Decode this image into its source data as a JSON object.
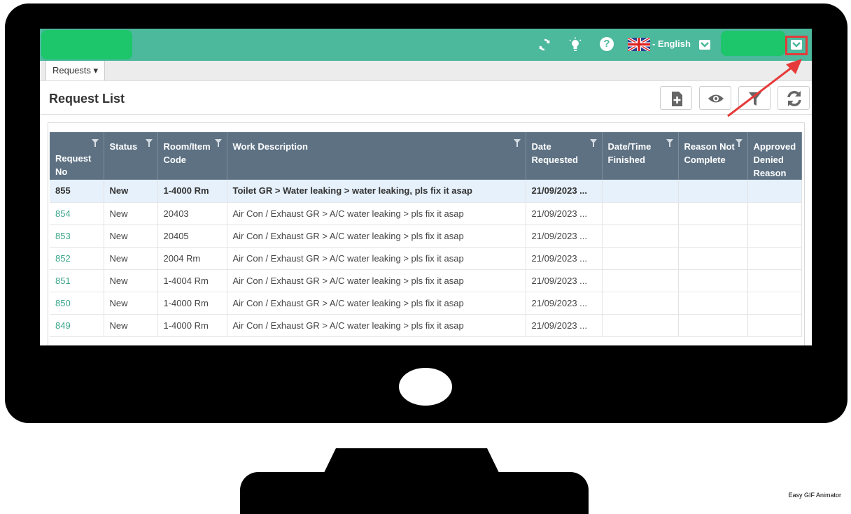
{
  "header": {
    "language": "- English"
  },
  "nav": {
    "requests_menu": "Requests ▾"
  },
  "page": {
    "title": "Request List"
  },
  "table": {
    "headers": [
      "Request No",
      "Status",
      "Room/Item Code",
      "Work Description",
      "Date Requested",
      "Date/Time Finished",
      "Reason Not Complete",
      "Approved Denied Reason"
    ],
    "rows": [
      [
        "855",
        "New",
        "1-4000 Rm",
        "Toilet GR > Water leaking > water leaking, pls fix it asap",
        "21/09/2023 ...",
        "",
        "",
        ""
      ],
      [
        "854",
        "New",
        "20403",
        "Air Con / Exhaust GR > A/C water leaking > pls fix it asap",
        "21/09/2023 ...",
        "",
        "",
        ""
      ],
      [
        "853",
        "New",
        "20405",
        "Air Con / Exhaust GR > A/C water leaking > pls fix it asap",
        "21/09/2023 ...",
        "",
        "",
        ""
      ],
      [
        "852",
        "New",
        "2004 Rm",
        "Air Con / Exhaust GR > A/C water leaking > pls fix it asap",
        "21/09/2023 ...",
        "",
        "",
        ""
      ],
      [
        "851",
        "New",
        "1-4004 Rm",
        "Air Con / Exhaust GR > A/C water leaking > pls fix it asap",
        "21/09/2023 ...",
        "",
        "",
        ""
      ],
      [
        "850",
        "New",
        "1-4000 Rm",
        "Air Con / Exhaust GR > A/C water leaking > pls fix it asap",
        "21/09/2023 ...",
        "",
        "",
        ""
      ],
      [
        "849",
        "New",
        "1-4000 Rm",
        "Air Con / Exhaust GR > A/C water leaking > pls fix it asap",
        "21/09/2023 ...",
        "",
        "",
        ""
      ]
    ],
    "selected_row": 0
  },
  "toolbar": {
    "icons": [
      "new-document-icon",
      "eye-icon",
      "filter-icon",
      "refresh-icon"
    ]
  },
  "top_icons": [
    "sync-icon",
    "lightbulb-icon",
    "help-icon",
    "uk-flag-icon",
    "chevron-down-icon"
  ],
  "colors": {
    "topbar": "#4cb89c",
    "header_row": "#5d7183",
    "link_green": "#3aa58a",
    "highlight_red": "#e63a3a",
    "redacted_green": "#1dc56b"
  },
  "watermark": "Easy GIF Animator"
}
